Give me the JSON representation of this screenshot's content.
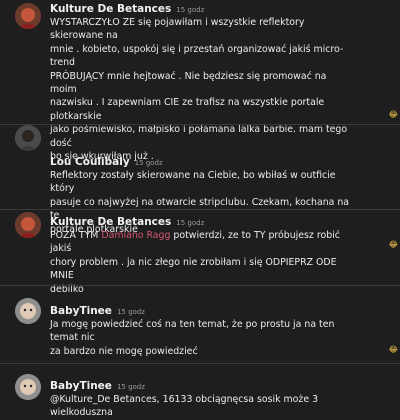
{
  "comments": [
    {
      "author": "Kulture De Betances",
      "time": "15 godz",
      "lines": [
        "WYSTARCZYŁO ZE się pojawiłam i wszystkie reflektory skierowane na",
        "mnie . kobieto, uspokój się i przestań organizować jakiś micro-trend",
        "PRÓBUJĄCY mnie hejtować . Nie będziesz się promować na moim",
        "nazwisku . I zapewniam CIE ze trafisz na wszystkie portale plotkarskie",
        "jako pośmiewisko, małpisko i połamana lalka barbie. mam tego dość",
        "bo się wkurwiłam już ."
      ]
    },
    {
      "author": "Lou Coulibaly",
      "time": "15 godz",
      "lines": [
        "Reflektory zostały skierowane na Ciebie, bo wbiłaś w outficie który",
        "pasuje co najwyżej na otwarcie stripclubu. Czekam, kochana na te",
        "portale plotkarskie"
      ]
    },
    {
      "author": "Kulture De Betances",
      "time": "15 godz",
      "line1_before": "POZA TYM ",
      "mention": "Damiano Ragg",
      "line1_after": " potwierdzi, ze to TY próbujesz robić jakiś",
      "lines": [
        "chory problem . ja nic złego nie zrobiłam i się ODPIEPRZ ODE MNIE",
        "debilko"
      ]
    },
    {
      "author": "BabyTinee",
      "time": "15 godz",
      "lines": [
        "Ja mogę powiedzieć coś na ten temat, że po prostu ja na ten temat nic",
        "za bardzo nie mogę powiedzieć"
      ]
    },
    {
      "author": "BabyTinee",
      "time": "15 godz",
      "lines": [
        "@Kulture_De Betances, 16133 obciągnęcsa sosik może 3 wielkoduszna"
      ]
    }
  ]
}
